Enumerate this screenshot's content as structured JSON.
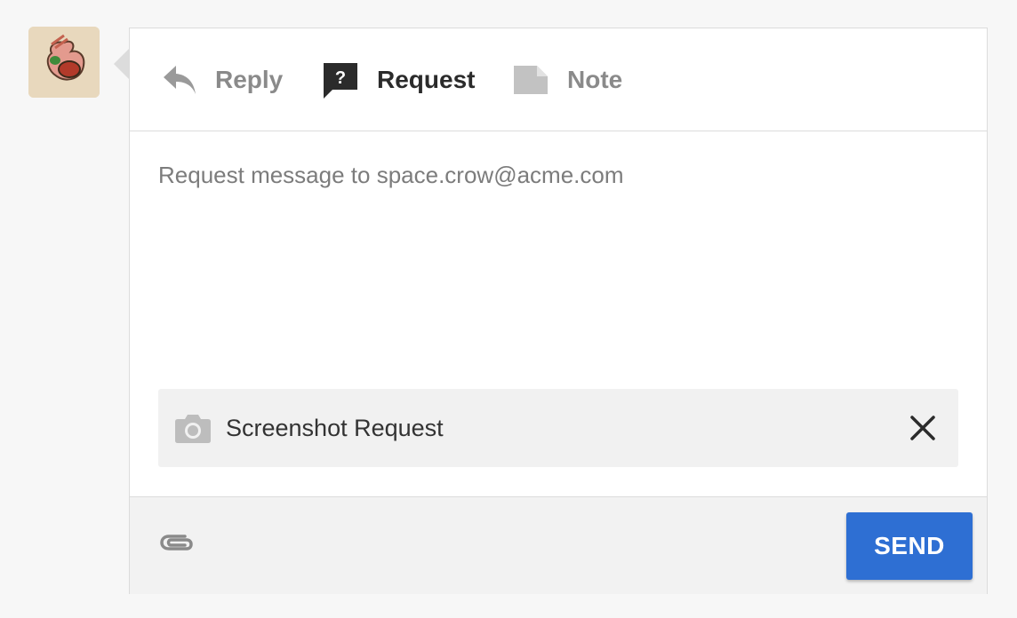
{
  "tabs": {
    "reply": {
      "label": "Reply",
      "icon": "reply-icon"
    },
    "request": {
      "label": "Request",
      "icon": "question-bubble-icon"
    },
    "note": {
      "label": "Note",
      "icon": "note-icon"
    },
    "active": "request"
  },
  "composer": {
    "placeholder": "Request message to space.crow@acme.com",
    "value": ""
  },
  "attachment": {
    "label": "Screenshot Request",
    "icon": "camera-icon",
    "close_icon": "close-icon"
  },
  "footer": {
    "attach_icon": "paperclip-icon",
    "send_label": "SEND"
  },
  "colors": {
    "accent": "#2e6fd3",
    "active_tab": "#2b2b2b",
    "inactive_tab": "#8a8a8a"
  }
}
